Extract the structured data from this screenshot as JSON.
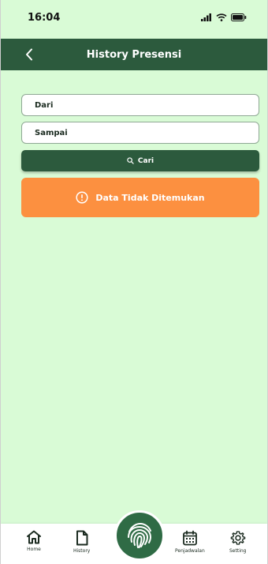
{
  "status_bar": {
    "time": "16:04"
  },
  "header": {
    "title": "History Presensi"
  },
  "filters": {
    "from_placeholder": "Dari",
    "to_placeholder": "Sampai",
    "search_label": "Cari"
  },
  "alert": {
    "message": "Data Tidak Ditemukan"
  },
  "bottom_nav": {
    "items": [
      {
        "label": "Home",
        "icon": "home-icon"
      },
      {
        "label": "History",
        "icon": "document-icon"
      },
      {
        "label": "Penjadwalan",
        "icon": "calendar-icon"
      },
      {
        "label": "Setting",
        "icon": "gear-icon"
      }
    ],
    "center_icon": "fingerprint-icon"
  },
  "colors": {
    "background": "#d9fbd6",
    "primary": "#2c5a3d",
    "alert": "#fc9040"
  }
}
